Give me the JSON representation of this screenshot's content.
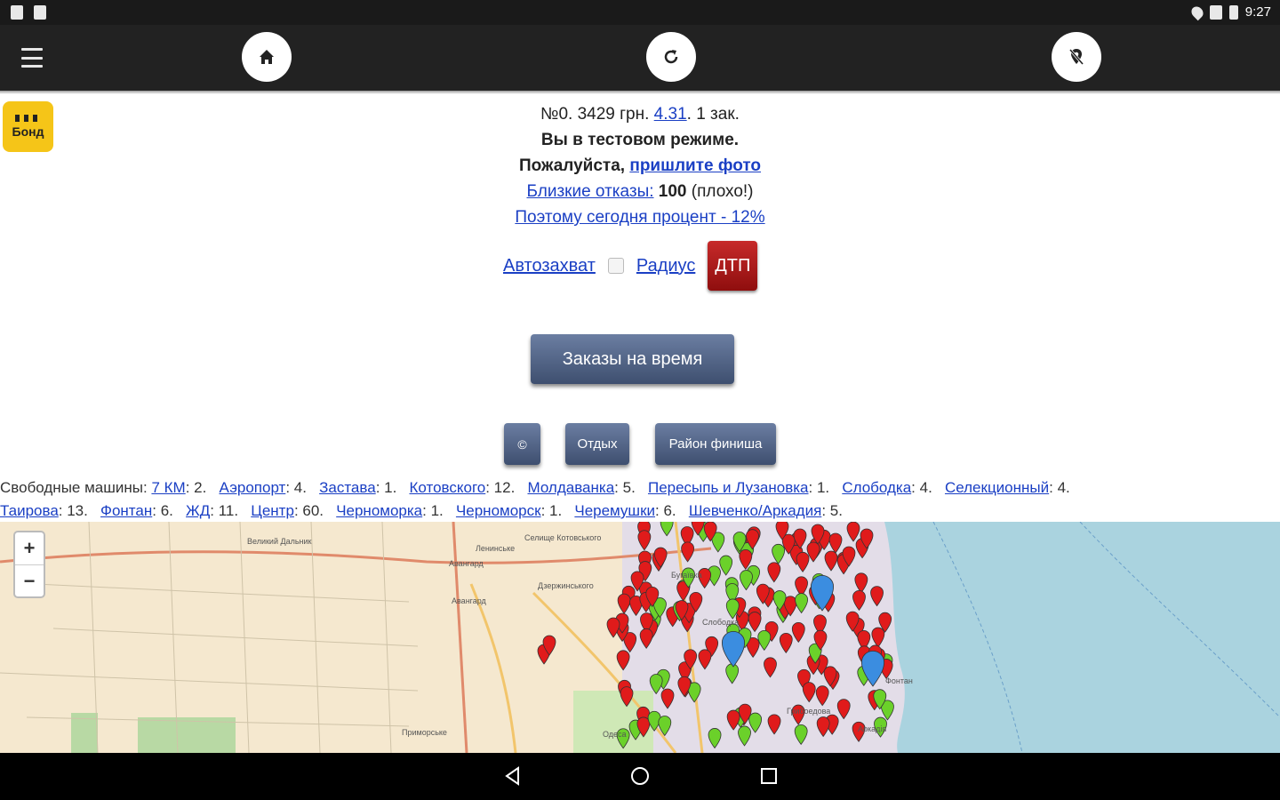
{
  "status_bar": {
    "time": "9:27",
    "left_icons": [
      "sd-card-icon",
      "sd-card-icon"
    ],
    "right_icons": [
      "location-icon",
      "signal-icon",
      "battery-icon"
    ]
  },
  "toolbar": {
    "menu_icon": "hamburger-menu-icon",
    "home_icon": "home-icon",
    "refresh_icon": "refresh-icon",
    "location_off_icon": "location-off-icon"
  },
  "logo": {
    "text": "Бонд",
    "color": "#f5c518"
  },
  "info": {
    "line1_prefix": "№0. 3429 грн. ",
    "line1_link": "4.31",
    "line1_suffix": ". 1 зак.",
    "line2": "Вы в тестовом режиме.",
    "line3_prefix": "Пожалуйста, ",
    "line3_link": "пришлите фото",
    "line4_link": "Близкие отказы:",
    "line4_value": " 100",
    "line4_suffix": " (плохо!)",
    "line5_link": "Поэтому сегодня процент - 12%"
  },
  "controls": {
    "autocapture_label": "Автозахват",
    "radius_label": "Радиус",
    "dtp_label": "ДТП"
  },
  "buttons": {
    "orders_by_time": "Заказы на время",
    "small_icon": "©",
    "rest": "Отдых",
    "finish_area": "Район финиша"
  },
  "free_cars": {
    "label": "Свободные машины:",
    "line1": [
      {
        "name": "7 КМ",
        "count": ": 2."
      },
      {
        "name": "Аэропорт",
        "count": ": 4."
      },
      {
        "name": "Застава",
        "count": ": 1."
      },
      {
        "name": "Котовского",
        "count": ": 12."
      },
      {
        "name": "Молдаванка",
        "count": ": 5."
      },
      {
        "name": "Пересыпь и Лузановка",
        "count": ": 1."
      },
      {
        "name": "Слободка",
        "count": ": 4."
      },
      {
        "name": "Селекционный",
        "count": ": 4."
      }
    ],
    "line2": [
      {
        "name": "Таирова",
        "count": ": 13."
      },
      {
        "name": "Фонтан",
        "count": ": 6."
      },
      {
        "name": "ЖД",
        "count": ": 11."
      },
      {
        "name": "Центр",
        "count": ": 60."
      },
      {
        "name": "Черноморка",
        "count": ": 1."
      },
      {
        "name": "Черноморск",
        "count": ": 1."
      },
      {
        "name": "Черемушки",
        "count": ": 6."
      },
      {
        "name": "Шевченко/Аркадия",
        "count": ": 5."
      }
    ]
  },
  "map": {
    "zoom_in": "+",
    "zoom_out": "−",
    "labels": [
      "Великий Дальник",
      "Ленинське",
      "Авангард",
      "Селище Котовського",
      "Авангард",
      "Приморське",
      "Дзержинського",
      "Бугаївка",
      "Слободка",
      "Фонтан",
      "Аркадія",
      "Грибоедова",
      "Одеса"
    ],
    "colors": {
      "land": "#f2efe9",
      "sea": "#aad3df",
      "green_pin": "#6bd12a",
      "red_pin": "#e01b1b",
      "blue_pin": "#3b8de0"
    }
  },
  "navbar": {
    "back_icon": "back-icon",
    "home_icon": "home-circle-icon",
    "recents_icon": "recents-square-icon"
  }
}
